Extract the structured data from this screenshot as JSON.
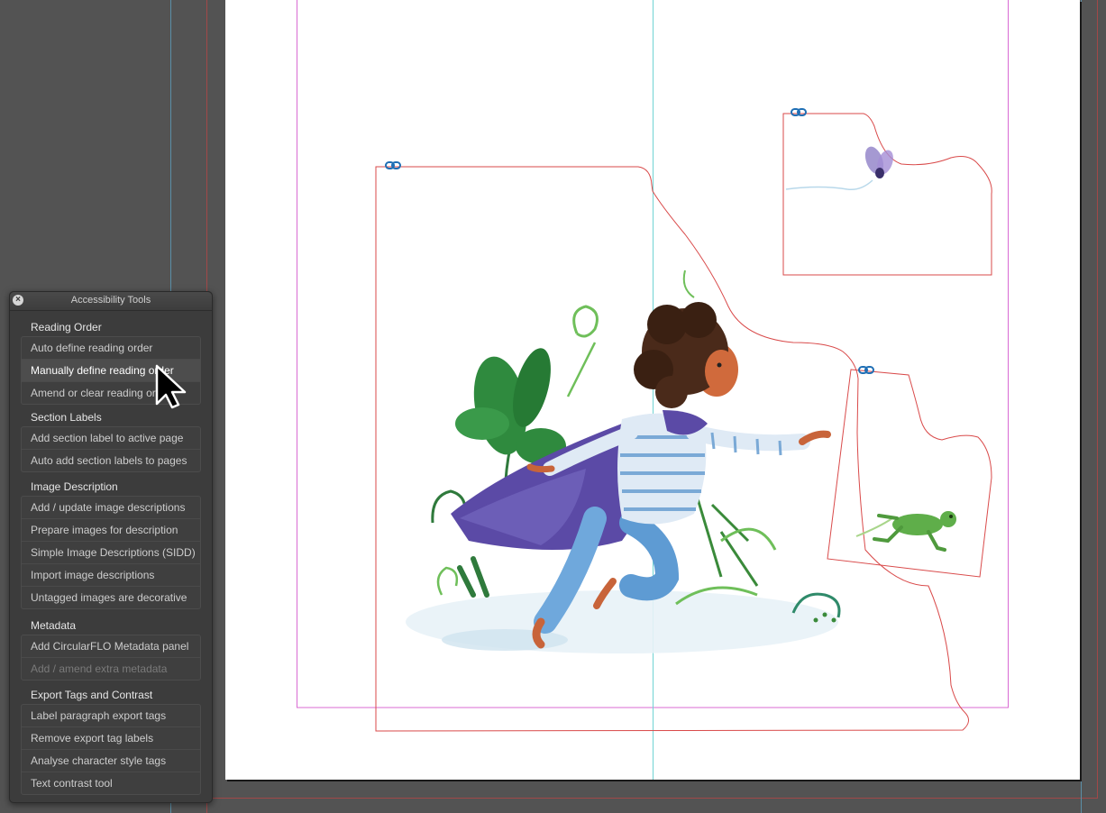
{
  "panel": {
    "title": "Accessibility Tools",
    "sections": [
      {
        "heading": "Reading Order",
        "items": [
          {
            "label": "Auto define reading order"
          },
          {
            "label": "Manually define reading order"
          },
          {
            "label": "Amend or clear reading order"
          }
        ]
      },
      {
        "heading": "Section Labels",
        "items": [
          {
            "label": "Add section label to active page"
          },
          {
            "label": "Auto add section labels to pages"
          }
        ]
      },
      {
        "heading": "Image Description",
        "items": [
          {
            "label": "Add / update image descriptions"
          },
          {
            "label": "Prepare images for description"
          },
          {
            "label": "Simple Image Descriptions (SIDD)"
          },
          {
            "label": "Import image descriptions"
          },
          {
            "label": "Untagged images are decorative"
          }
        ]
      },
      {
        "heading": "Metadata",
        "items": [
          {
            "label": "Add CircularFLO Metadata panel"
          },
          {
            "label": "Add / amend extra metadata"
          }
        ]
      },
      {
        "heading": "Export Tags and Contrast",
        "items": [
          {
            "label": "Label paragraph export tags"
          },
          {
            "label": "Remove export tag labels"
          },
          {
            "label": "Analyse character style tags"
          },
          {
            "label": "Text contrast tool"
          }
        ]
      }
    ]
  },
  "colors": {
    "pasteboard": "#535353",
    "page": "#ffffff",
    "margin_guide": "#d96bd3",
    "column_guide": "#6fd3d3",
    "frame_outline": "#d94a4a",
    "link_icon": "#1f6fb5"
  },
  "icons": {
    "close": "close-icon",
    "link": "link-icon",
    "cursor": "arrow-cursor-icon"
  }
}
